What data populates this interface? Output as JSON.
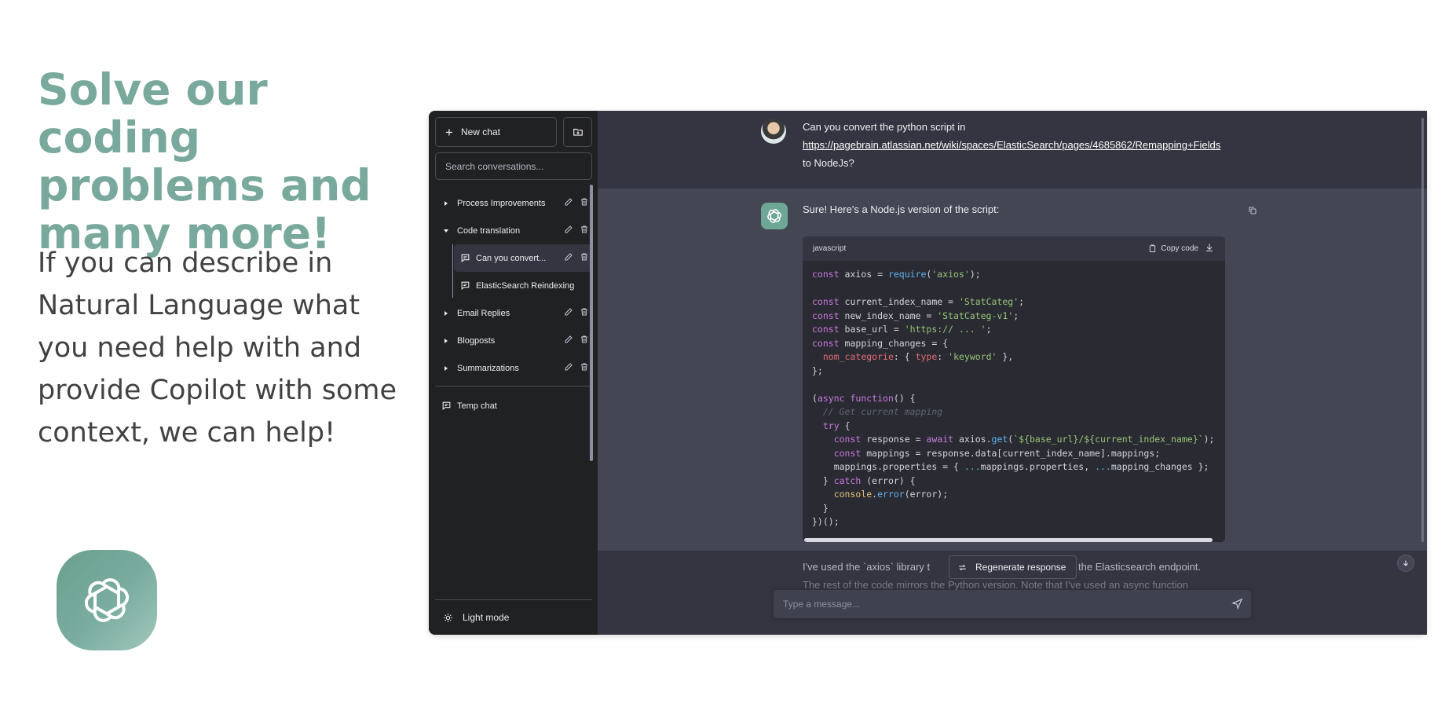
{
  "hero": {
    "title": "Solve our coding problems and many more!",
    "text": "If you can describe in Natural Language what you need help with and provide Copilot with some context, we can help!"
  },
  "sidebar": {
    "new_chat": "New chat",
    "search_placeholder": "Search conversations...",
    "folders": [
      {
        "label": "Process Improvements"
      },
      {
        "label": "Code translation"
      },
      {
        "label": "Email Replies"
      },
      {
        "label": "Blogposts"
      },
      {
        "label": "Summarizations"
      }
    ],
    "conversations": [
      {
        "label": "Can you convert..."
      },
      {
        "label": "ElasticSearch Reindexing"
      }
    ],
    "temp_chat": "Temp chat",
    "light_mode": "Light mode"
  },
  "chat": {
    "user_message_prefix": "Can you convert the python script in",
    "user_message_link": "https://pagebrain.atlassian.net/wiki/spaces/ElasticSearch/pages/4685862/Remapping+Fields",
    "user_message_suffix": "to NodeJs?",
    "bot_intro": "Sure! Here's a Node.js version of the script:",
    "code_language": "javascript",
    "copy_code": "Copy code",
    "after_text_1": "I've used the `axios` library t",
    "after_text_2": "o the Elasticsearch endpoint.",
    "after_text_3": "The rest of the code mirrors the Python version. Note that I've used an async function",
    "regenerate": "Regenerate response",
    "input_placeholder": "Type a message..."
  },
  "colors": {
    "hero_title": "#78a99c",
    "hero_text": "#424242",
    "app_bg": "#343541",
    "sidebar_bg": "#202123",
    "assistant_bg": "#444654",
    "accent_green": "#6fa797"
  },
  "icons": [
    "openai-logo-icon",
    "plus-icon",
    "new-folder-icon",
    "caret-right-icon",
    "caret-down-icon",
    "edit-icon",
    "trash-icon",
    "chat-bubble-icon",
    "sun-icon",
    "collapse-sidebar-icon",
    "copy-icon",
    "download-icon",
    "refresh-icon",
    "arrow-down-icon",
    "send-icon"
  ]
}
